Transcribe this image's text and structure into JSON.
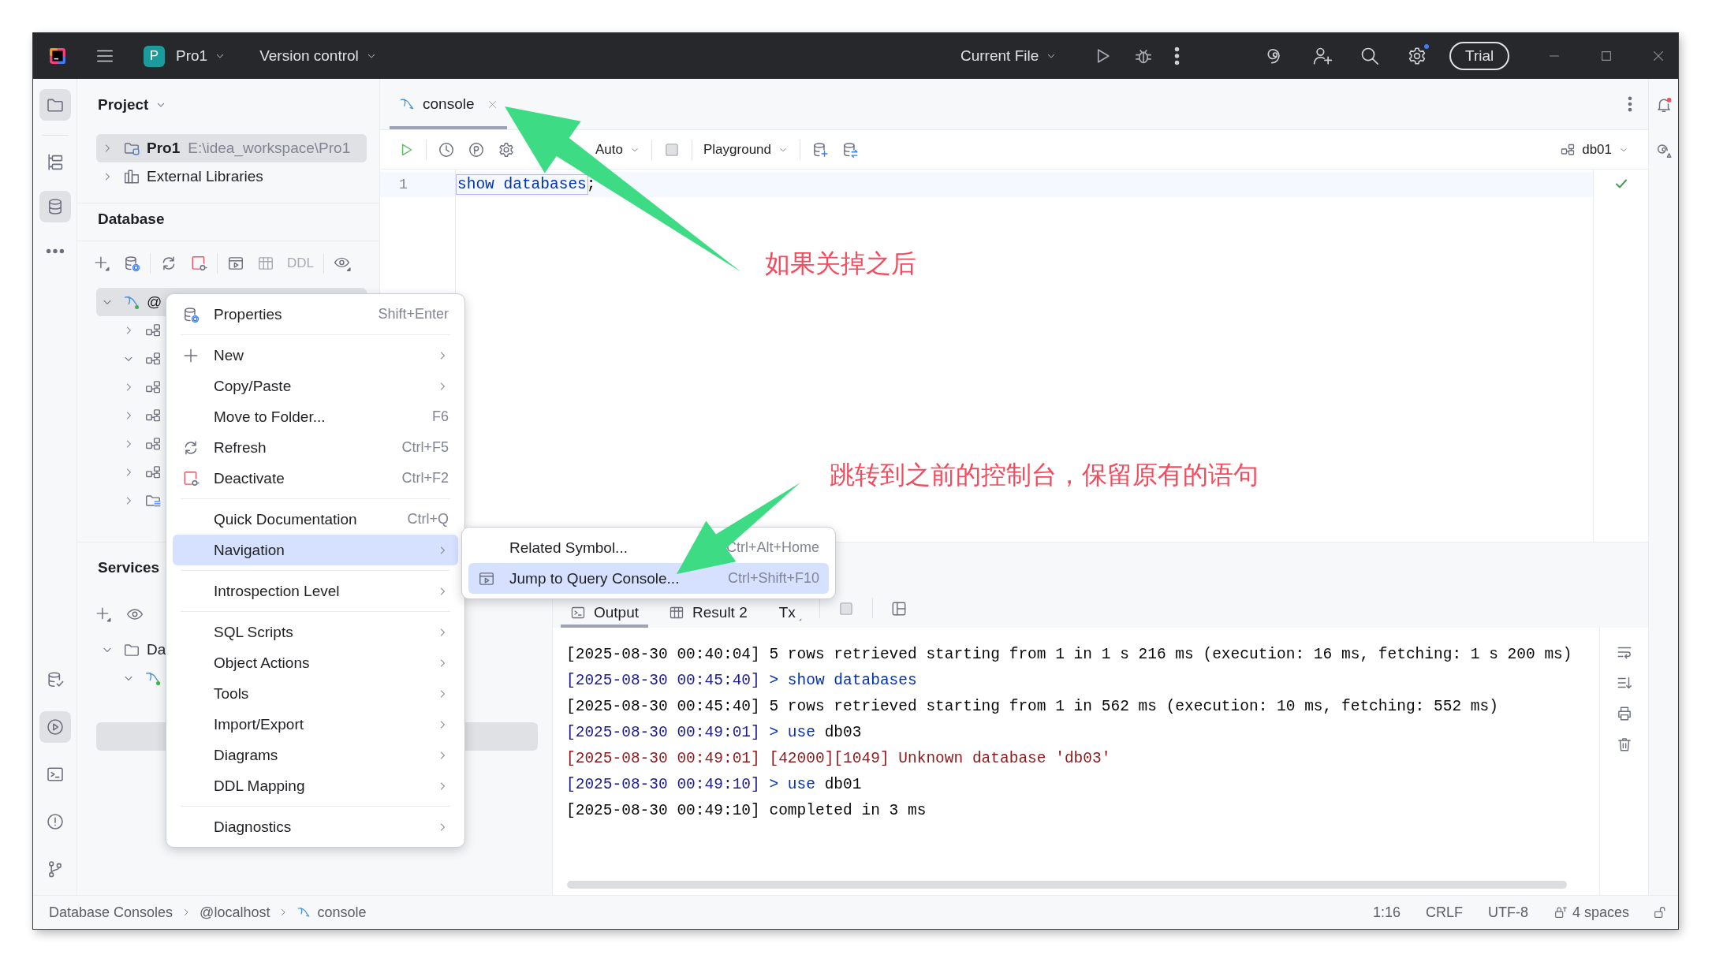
{
  "title_bar": {
    "project_initial": "P",
    "project": "Pro1",
    "vcs": "Version control",
    "run_config": "Current File",
    "trial": "Trial"
  },
  "left_toolbar": {
    "top": [
      {
        "kind": "project",
        "active": true
      },
      {
        "kind": "structure",
        "active": false
      },
      {
        "kind": "database",
        "active": true
      },
      {
        "kind": "more",
        "active": false
      }
    ],
    "bottom": [
      {
        "kind": "database-list",
        "active": false
      },
      {
        "kind": "services",
        "active": true
      },
      {
        "kind": "terminal",
        "active": false
      },
      {
        "kind": "problems",
        "active": false
      },
      {
        "kind": "git",
        "active": false
      }
    ]
  },
  "project_panel": {
    "title": "Project",
    "tree": [
      {
        "kind": "project",
        "label": "Pro1",
        "path": "E:\\idea_workspace\\Pro1",
        "expanded": false,
        "selected": true
      },
      {
        "kind": "libraries",
        "label": "External Libraries",
        "expanded": false,
        "selected": false
      }
    ]
  },
  "database_panel": {
    "title": "Database",
    "ddl": "DDL",
    "tree": [
      {
        "kind": "datasource",
        "label": "@",
        "expanded": true,
        "selected": true,
        "children": [
          {
            "kind": "schema",
            "expanded": false,
            "selected": false
          },
          {
            "kind": "schema",
            "expanded": true,
            "selected": false
          },
          {
            "kind": "schema",
            "expanded": false,
            "selected": false
          },
          {
            "kind": "schema",
            "expanded": false,
            "selected": false
          },
          {
            "kind": "schema",
            "expanded": false,
            "selected": false
          },
          {
            "kind": "schema",
            "expanded": false,
            "selected": false
          },
          {
            "kind": "consoles",
            "expanded": false,
            "selected": false
          }
        ]
      }
    ]
  },
  "services_panel": {
    "title": "Services",
    "tree": [
      {
        "kind": "folder",
        "label": "Da",
        "expanded": true,
        "selected": false,
        "children": [
          {
            "kind": "datasource",
            "expanded": true,
            "selected": false,
            "children": [
              {
                "selected": true
              }
            ]
          }
        ]
      }
    ]
  },
  "editor": {
    "tabs": [
      {
        "label": "console",
        "selected": true
      }
    ],
    "toolbar": {
      "tx_mode": "Auto",
      "schema_mode": "Playground",
      "datasource": "db01"
    },
    "lines": [
      {
        "number": "1",
        "tokens": [
          {
            "kind": "keyword",
            "text": "show databases"
          },
          {
            "kind": "punct",
            "text": ";"
          }
        ]
      }
    ],
    "inspection_ok": true
  },
  "output": {
    "tabs": [
      {
        "kind": "output",
        "label": "Output",
        "selected": true
      },
      {
        "kind": "result",
        "label": "Result 2",
        "selected": false
      }
    ],
    "tx": "Tx",
    "log": [
      {
        "kind": "result",
        "time": "[2025-08-30 00:40:04]",
        "text": "5 rows retrieved starting from 1 in 1 s 216 ms (execution: 16 ms, fetching: 1 s 200 ms)"
      },
      {
        "kind": "query",
        "time": "[2025-08-30 00:45:40]",
        "text": "> show databases"
      },
      {
        "kind": "result",
        "time": "[2025-08-30 00:45:40]",
        "text": "5 rows retrieved starting from 1 in 562 ms (execution: 10 ms, fetching: 552 ms)"
      },
      {
        "kind": "query",
        "time": "[2025-08-30 00:49:01]",
        "text": "> use",
        "argument": "db03"
      },
      {
        "kind": "error",
        "time": "[2025-08-30 00:49:01]",
        "text": "[42000][1049] Unknown database 'db03'"
      },
      {
        "kind": "query",
        "time": "[2025-08-30 00:49:10]",
        "text": "> use",
        "argument": "db01"
      },
      {
        "kind": "result",
        "time": "[2025-08-30 00:49:10]",
        "text": "completed in 3 ms"
      }
    ]
  },
  "context_menu": {
    "sections": [
      [
        {
          "label": "Properties",
          "shortcut": "Shift+Enter",
          "submenu": false,
          "selected": false
        }
      ],
      [
        {
          "label": "New",
          "submenu": true,
          "selected": false
        },
        {
          "label": "Copy/Paste",
          "submenu": true,
          "selected": false
        },
        {
          "label": "Move to Folder...",
          "shortcut": "F6",
          "submenu": false,
          "selected": false
        },
        {
          "label": "Refresh",
          "shortcut": "Ctrl+F5",
          "submenu": false,
          "selected": false
        },
        {
          "label": "Deactivate",
          "shortcut": "Ctrl+F2",
          "submenu": false,
          "selected": false
        }
      ],
      [
        {
          "label": "Quick Documentation",
          "shortcut": "Ctrl+Q",
          "submenu": false,
          "selected": false
        },
        {
          "label": "Navigation",
          "submenu": true,
          "selected": true
        }
      ],
      [
        {
          "label": "Introspection Level",
          "submenu": true,
          "selected": false
        }
      ],
      [
        {
          "label": "SQL Scripts",
          "submenu": true,
          "selected": false
        },
        {
          "label": "Object Actions",
          "submenu": true,
          "selected": false
        },
        {
          "label": "Tools",
          "submenu": true,
          "selected": false
        },
        {
          "label": "Import/Export",
          "submenu": true,
          "selected": false
        },
        {
          "label": "Diagrams",
          "submenu": true,
          "selected": false
        },
        {
          "label": "DDL Mapping",
          "submenu": true,
          "selected": false
        }
      ],
      [
        {
          "label": "Diagnostics",
          "submenu": true,
          "selected": false
        }
      ]
    ]
  },
  "submenu": {
    "items": [
      {
        "label": "Related Symbol...",
        "shortcut": "Ctrl+Alt+Home",
        "selected": false
      },
      {
        "label": "Jump to Query Console...",
        "shortcut": "Ctrl+Shift+F10",
        "selected": true
      }
    ]
  },
  "status_bar": {
    "breadcrumbs": [
      {
        "label": "Database Consoles"
      },
      {
        "label": "@localhost"
      },
      {
        "kind": "console",
        "label": "console"
      }
    ],
    "position": "1:16",
    "line_ending": "CRLF",
    "encoding": "UTF-8",
    "indent": "4 spaces"
  },
  "annotations": [
    {
      "text": "如果关掉之后"
    },
    {
      "text": "跳转到之前的控制台，保留原有的语句"
    }
  ]
}
